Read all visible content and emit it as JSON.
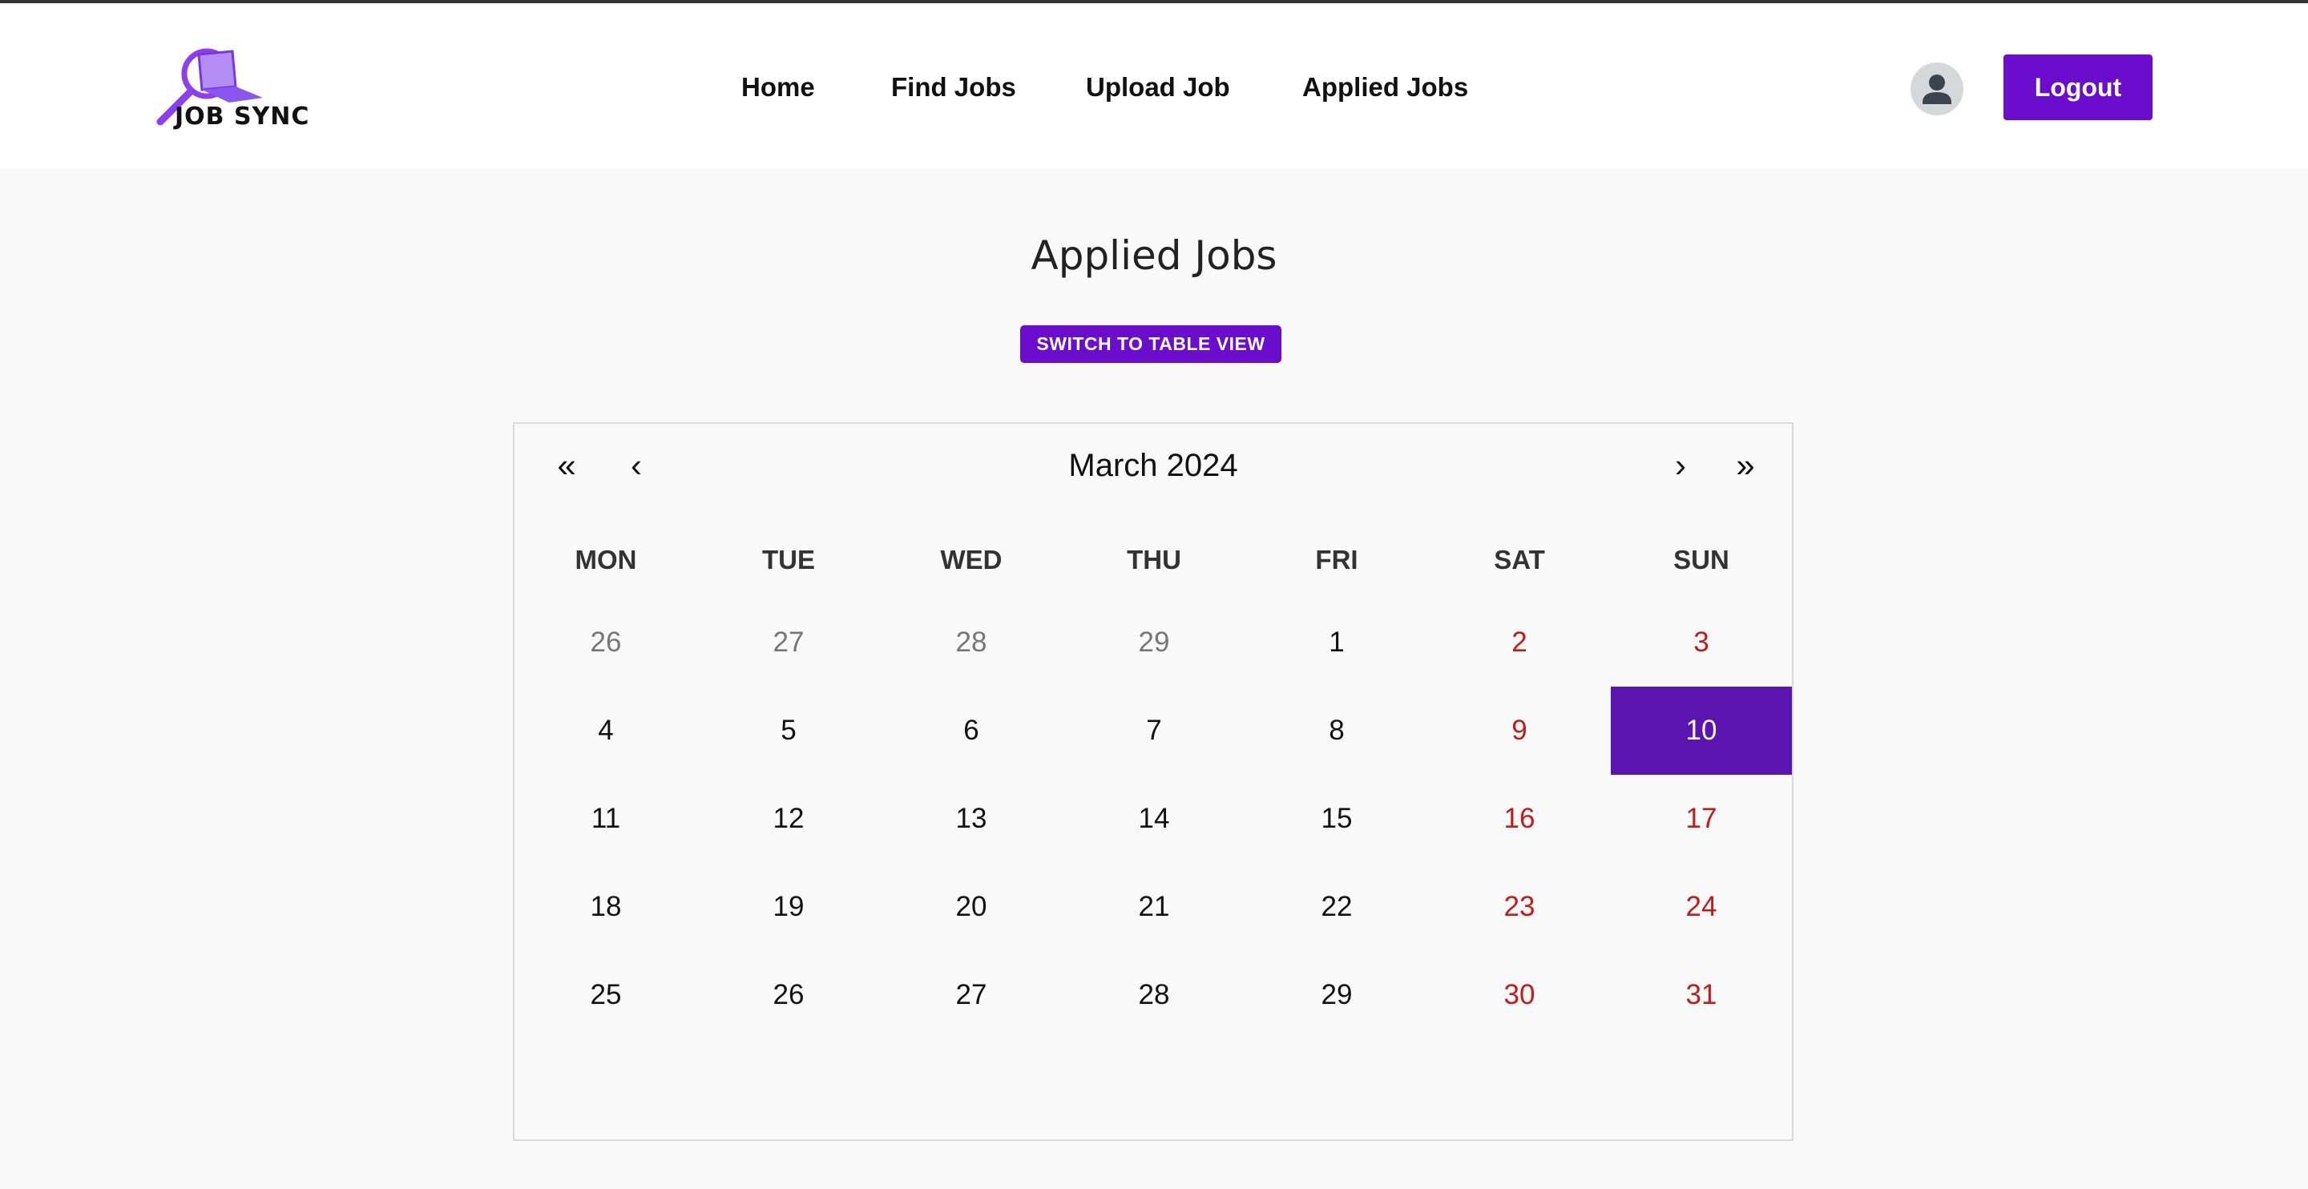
{
  "header": {
    "logo_text": "JOB SYNC",
    "nav": [
      {
        "label": "Home"
      },
      {
        "label": "Find Jobs"
      },
      {
        "label": "Upload Job"
      },
      {
        "label": "Applied Jobs"
      }
    ],
    "avatar_icon": "user-icon",
    "logout_label": "Logout"
  },
  "main": {
    "title": "Applied Jobs",
    "switch_view_label": "SWITCH TO TABLE VIEW"
  },
  "calendar": {
    "month_label": "March 2024",
    "prev_year": "«",
    "prev_month": "‹",
    "next_month": "›",
    "next_year": "»",
    "weekdays": [
      "MON",
      "TUE",
      "WED",
      "THU",
      "FRI",
      "SAT",
      "SUN"
    ],
    "days": [
      {
        "label": "26",
        "type": "neighbor"
      },
      {
        "label": "27",
        "type": "neighbor"
      },
      {
        "label": "28",
        "type": "neighbor"
      },
      {
        "label": "29",
        "type": "neighbor"
      },
      {
        "label": "1",
        "type": "normal"
      },
      {
        "label": "2",
        "type": "weekend"
      },
      {
        "label": "3",
        "type": "weekend"
      },
      {
        "label": "4",
        "type": "normal"
      },
      {
        "label": "5",
        "type": "normal"
      },
      {
        "label": "6",
        "type": "normal"
      },
      {
        "label": "7",
        "type": "normal"
      },
      {
        "label": "8",
        "type": "normal"
      },
      {
        "label": "9",
        "type": "weekend"
      },
      {
        "label": "10",
        "type": "active"
      },
      {
        "label": "11",
        "type": "normal"
      },
      {
        "label": "12",
        "type": "normal"
      },
      {
        "label": "13",
        "type": "normal"
      },
      {
        "label": "14",
        "type": "normal"
      },
      {
        "label": "15",
        "type": "normal"
      },
      {
        "label": "16",
        "type": "weekend"
      },
      {
        "label": "17",
        "type": "weekend"
      },
      {
        "label": "18",
        "type": "normal"
      },
      {
        "label": "19",
        "type": "normal"
      },
      {
        "label": "20",
        "type": "normal"
      },
      {
        "label": "21",
        "type": "normal"
      },
      {
        "label": "22",
        "type": "normal"
      },
      {
        "label": "23",
        "type": "weekend"
      },
      {
        "label": "24",
        "type": "weekend"
      },
      {
        "label": "25",
        "type": "normal"
      },
      {
        "label": "26",
        "type": "normal"
      },
      {
        "label": "27",
        "type": "normal"
      },
      {
        "label": "28",
        "type": "normal"
      },
      {
        "label": "29",
        "type": "normal"
      },
      {
        "label": "30",
        "type": "weekend"
      },
      {
        "label": "31",
        "type": "weekend"
      }
    ]
  },
  "colors": {
    "accent": "#6a0dcc",
    "active_day": "#5a14b0",
    "weekend": "#c41a1a",
    "neighbor_day": "#767676",
    "background": "#f9f9f9"
  }
}
